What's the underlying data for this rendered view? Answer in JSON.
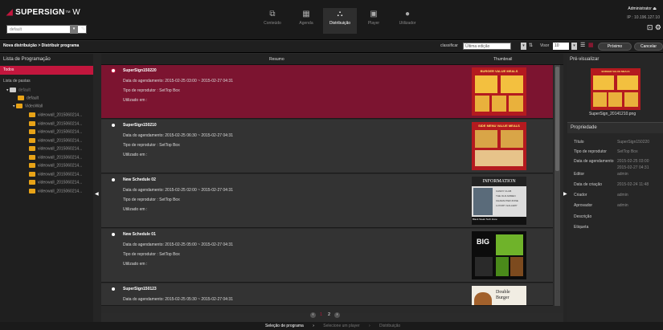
{
  "app": {
    "logo_text": "SUPERSIGN",
    "logo_suffix": "W",
    "select_value": "default"
  },
  "nav": [
    {
      "label": "Conteúdo",
      "icon": "content-icon"
    },
    {
      "label": "Agenda",
      "icon": "calendar-icon"
    },
    {
      "label": "Distribuição",
      "icon": "distribution-icon"
    },
    {
      "label": "Player",
      "icon": "player-icon"
    },
    {
      "label": "Utilizador",
      "icon": "user-icon"
    }
  ],
  "header": {
    "user": "Administrator",
    "ip": "IP : 10.196.127.10"
  },
  "toolbar": {
    "breadcrumb": "Nova distribuição > Distribuir programa",
    "sort_label": "classificar",
    "sort_value": "Última edição",
    "view_label": "Visor",
    "view_value": "10",
    "next": "Próximo",
    "cancel": "Cancelar"
  },
  "left": {
    "title": "Lista de Programação",
    "all": "Todos",
    "list_label": "Lista de pastas",
    "root": "default",
    "sub_default": "default",
    "videowall": "VideoWall",
    "items": [
      "videowall_2015060214...",
      "videowall_2015060214...",
      "videowall_2015060214...",
      "videowall_2015060214...",
      "videowall_2015060214...",
      "videowall_2015060214...",
      "videowall_2015060214...",
      "videowall_2015060214...",
      "videowall_2015060214...",
      "videowall_2015060214..."
    ]
  },
  "table": {
    "h_resumo": "Resumo",
    "h_thumb": "Thumbnail"
  },
  "rows": [
    {
      "title": "SuperSign150220",
      "date": "Data do agendamento: 2015-02-25 03:00 ~ 2015-02-27 04:31",
      "type": "Tipo de reprodutor : SetTop Box",
      "used": "Utilizado em :"
    },
    {
      "title": "SuperSign150210",
      "date": "Data do agendamento: 2015-02-25 06:30 ~ 2015-02-27 04:31",
      "type": "Tipo de reprodutor : SetTop Box",
      "used": "Utilizado em :"
    },
    {
      "title": "New Schedule 02",
      "date": "Data do agendamento: 2015-02-25 02:00 ~ 2015-02-27 04:31",
      "type": "Tipo de reprodutor : SetTop Box",
      "used": "Utilizado em :"
    },
    {
      "title": "New Schedule 01",
      "date": "Data do agendamento: 2015-02-25 05:00 ~ 2015-02-27 04:31",
      "type": "Tipo de reprodutor : SetTop Box",
      "used": "Utilizado em :"
    },
    {
      "title": "SuperSign150123",
      "date": "Data do agendamento: 2015-02-25 05:30 ~ 2015-02-27 04:31",
      "type": "",
      "used": ""
    }
  ],
  "thumbs": {
    "burger": "BURGER VALUE MEALS",
    "side": "SIDE MENU VALUE MEALS",
    "info": "INFORMATION",
    "info_items": [
      "CANDY CLUB",
      "THE OLD ARMEN",
      "CHARACTER ZONE",
      "LUXURY GALLERY"
    ],
    "info_foot": "Black Steak Tech Zone",
    "big": "BIG",
    "double": "Double",
    "double2": "Burger"
  },
  "pagination": {
    "p1": "1",
    "p2": "2"
  },
  "preview": {
    "title": "Pré-visualizar",
    "filename": "SuperSign_20141210.png"
  },
  "props": {
    "title": "Propriedade",
    "rows": [
      {
        "k": "Título",
        "v": "SuperSign150220"
      },
      {
        "k": "Tipo de reprodutor",
        "v": "SetTop Box"
      },
      {
        "k": "Data de agendamento",
        "v": "2015-02-25 03:00"
      },
      {
        "k": "",
        "v": "2015-02-27 04:31"
      },
      {
        "k": "Editor",
        "v": "admin"
      },
      {
        "k": "Data de criação",
        "v": "2015-02-24 11:48"
      },
      {
        "k": "Criador",
        "v": "admin"
      },
      {
        "k": "Aprovador",
        "v": "admin"
      },
      {
        "k": "Descrição",
        "v": ""
      },
      {
        "k": "Etiqueta",
        "v": ""
      }
    ]
  },
  "steps": {
    "s1": "Seleção de programa",
    "s2": "Selecione um player",
    "s3": "Distribuição"
  }
}
